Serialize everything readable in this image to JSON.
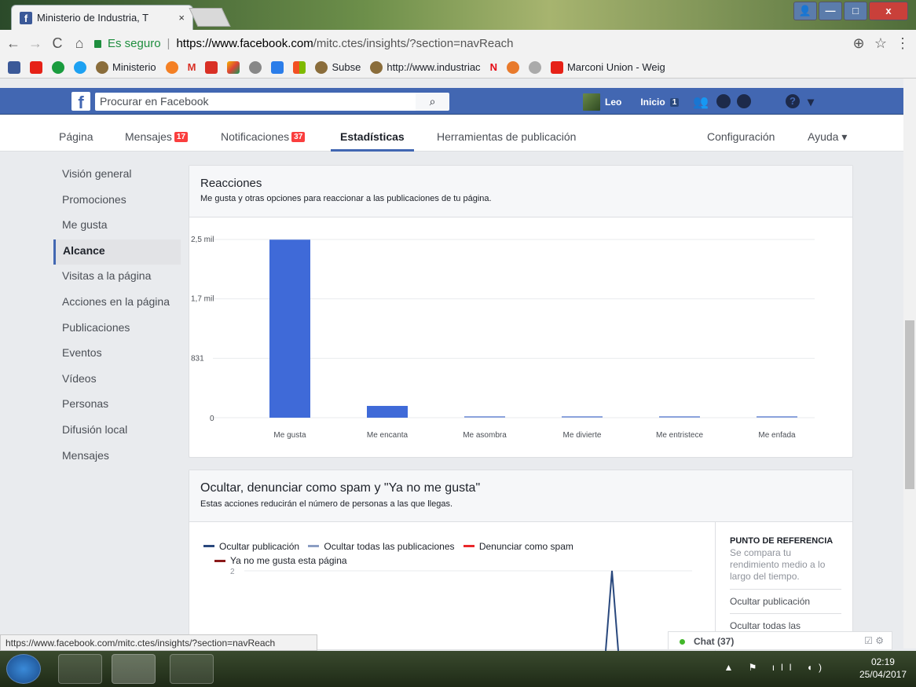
{
  "browser": {
    "tab_title": "Ministerio de Industria, T",
    "tab_close": "×",
    "nav_back": "←",
    "nav_forward": "→",
    "reload": "C",
    "home": "⌂",
    "secure_label": "Es seguro",
    "url_prefix": "https://www.facebook.com",
    "url_path": "/mitc.ctes/insights/?section=navReach",
    "zoom_icon": "⊕",
    "star_icon": "☆",
    "menu_icon": "⋮",
    "bookmarks": [
      {
        "label": "Ministerio",
        "color": "#8a6d3b"
      },
      {
        "label": "Subse",
        "color": "#8a6d3b"
      },
      {
        "label": "http://www.industriac",
        "color": "#8a6d3b"
      },
      {
        "label": "Marconi Union - Weig",
        "color": "#e62117"
      }
    ],
    "bookmark_M": "M",
    "bookmark_N": "N",
    "window_buttons": {
      "min": "—",
      "max": "□",
      "close": "x"
    }
  },
  "fb": {
    "logo": "f",
    "search_placeholder": "Procurar en Facebook",
    "search_icon": "⌕",
    "user_name": "Leo",
    "home_label": "Inicio",
    "home_count": "1",
    "help_icon": "?",
    "caret": "▾"
  },
  "page_nav": {
    "pagina": "Página",
    "mensajes": "Mensajes",
    "mensajes_count": "17",
    "notificaciones": "Notificaciones",
    "notificaciones_count": "37",
    "estadisticas": "Estadísticas",
    "herramientas": "Herramientas de publicación",
    "configuracion": "Configuración",
    "ayuda": "Ayuda ▾"
  },
  "sidebar": {
    "items": [
      "Visión general",
      "Promociones",
      "Me gusta",
      "Alcance",
      "Visitas a la página",
      "Acciones en la página",
      "Publicaciones",
      "Eventos",
      "Vídeos",
      "Personas",
      "Difusión local",
      "Mensajes"
    ],
    "active_index": 3
  },
  "reactions_card": {
    "title": "Reacciones",
    "subtitle": "Me gusta y otras opciones para reaccionar a las publicaciones de tu página."
  },
  "hide_card": {
    "title": "Ocultar, denunciar como spam y \"Ya no me gusta\"",
    "subtitle": "Estas acciones reducirán el número de personas a las que llegas.",
    "legend": [
      {
        "label": "Ocultar publicación",
        "color": "#29487d"
      },
      {
        "label": "Ocultar todas las publicaciones",
        "color": "#8b9dc3"
      },
      {
        "label": "Denunciar como spam",
        "color": "#e9282b"
      },
      {
        "label": "Ya no me gusta esta página",
        "color": "#8b1a1a"
      }
    ],
    "y_tick": "2",
    "benchmark": {
      "heading": "PUNTO DE REFERENCIA",
      "desc": "Se compara tu rendimiento medio a lo largo del tiempo.",
      "row1": "Ocultar publicación",
      "row2": "Ocultar todas las"
    }
  },
  "chart_data": [
    {
      "type": "bar",
      "categories": [
        "Me gusta",
        "Me encanta",
        "Me asombra",
        "Me divierte",
        "Me entristece",
        "Me enfada"
      ],
      "values": [
        2490,
        165,
        8,
        6,
        5,
        7
      ],
      "y_ticks": [
        "0",
        "831",
        "1,7 mil",
        "2,5 mil"
      ],
      "ylim": [
        0,
        2493
      ],
      "grid": true,
      "color": "#3f6ad8"
    },
    {
      "type": "line",
      "y_ticks": [
        "2"
      ],
      "note": "single spike reaching 2"
    }
  ],
  "status_url": "https://www.facebook.com/mitc.ctes/insights/?section=navReach",
  "chat": {
    "label": "Chat (37)",
    "icons": "☑ ⚙"
  },
  "taskbar": {
    "time": "02:19",
    "date": "25/04/2017",
    "tray": "▲ ⚑ ıll ◖)"
  }
}
